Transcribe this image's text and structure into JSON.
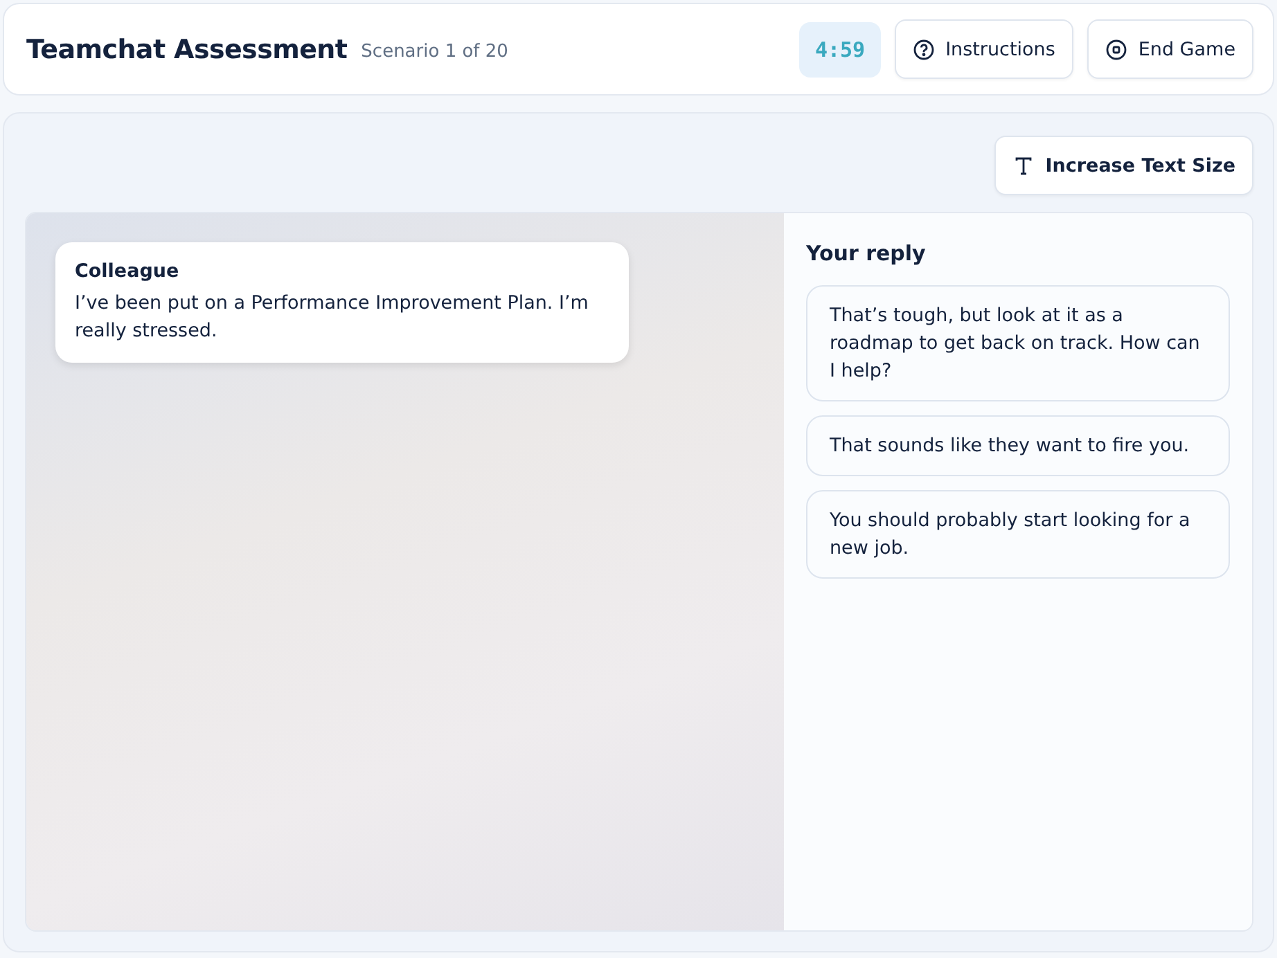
{
  "header": {
    "title": "Teamchat Assessment",
    "subtitle": "Scenario 1 of 20",
    "timer": "4:59",
    "buttons": [
      {
        "kind": "help",
        "label": "Instructions"
      },
      {
        "kind": "stop",
        "label": "End Game"
      }
    ]
  },
  "toolbar": {
    "text_size_button": "Increase Text Size"
  },
  "message": {
    "sender": "Colleague",
    "text": "I’ve been put on a Performance Improvement Plan. I’m really stressed."
  },
  "reply_panel": {
    "title": "Your reply",
    "options": [
      {
        "text": "That’s tough, but look at it as a roadmap to get back on track. How can I help?"
      },
      {
        "text": "That sounds like they want to fire you."
      },
      {
        "text": "You should probably start looking for a new job."
      }
    ]
  }
}
